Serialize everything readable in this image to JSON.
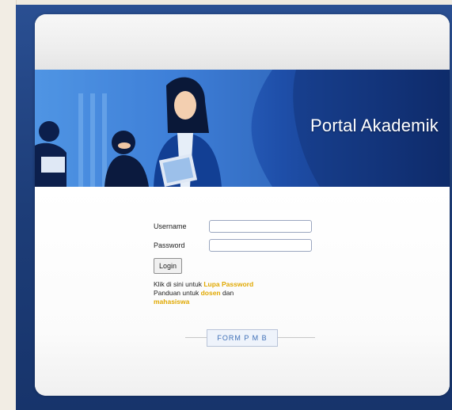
{
  "banner": {
    "title": "Portal Akademik"
  },
  "login": {
    "username_label": "Username",
    "password_label": "Password",
    "username_value": "",
    "password_value": "",
    "button_label": "Login"
  },
  "info": {
    "forgot_prefix": "Klik di sini untuk",
    "forgot_link": "Lupa Password",
    "guide_prefix": "Panduan untuk",
    "guide_link1": "dosen",
    "guide_mid": "dan",
    "guide_link2": "mahasiswa"
  },
  "footer": {
    "form_button": "FORM P M B"
  },
  "colors": {
    "frame": "#1b3d79",
    "banner_start": "#4b8fe0",
    "banner_end": "#0f2d6e",
    "link": "#e0a800",
    "form_text": "#3e6fb7"
  }
}
